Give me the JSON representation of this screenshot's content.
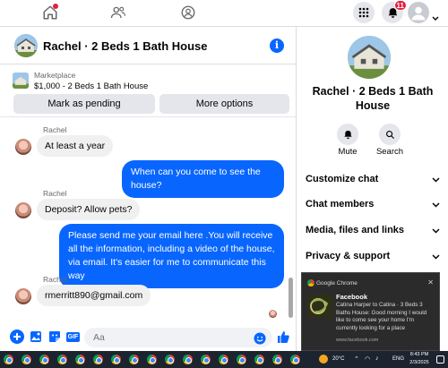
{
  "nav": {
    "notification_count": "11"
  },
  "chat": {
    "title": "Rachel · 2 Beds 1 Bath House",
    "marketplace_label": "Marketplace",
    "listing_price_title": "$1,000 - 2 Beds 1 Bath House",
    "mark_pending_label": "Mark as pending",
    "more_options_label": "More options",
    "messages": [
      {
        "sender": "Rachel",
        "text": "At least a year",
        "direction": "in"
      },
      {
        "text": "When can you come to see the house?",
        "direction": "out"
      },
      {
        "sender": "Rachel",
        "text": "Deposit? Allow pets?",
        "direction": "in"
      },
      {
        "text": "Please send me your email here .You will receive all the information, including a video of the house, via email. It's easier for me to communicate this way",
        "direction": "out"
      },
      {
        "sender": "Rachel",
        "text": "rmerritt890@gmail.com",
        "direction": "in"
      }
    ],
    "composer_placeholder": "Aa"
  },
  "right_panel": {
    "title": "Rachel · 2 Beds 1 Bath House",
    "mute_label": "Mute",
    "search_label": "Search",
    "rows": [
      "Customize chat",
      "Chat members",
      "Media, files and links",
      "Privacy & support"
    ]
  },
  "toast": {
    "app": "Google Chrome",
    "title": "Facebook",
    "body": "Catina Harper to Catina · 3 Beds 3 Baths House: Good morning I would like to come see your home I'm currently looking for a place",
    "link": "www.facebook.com"
  },
  "taskbar": {
    "temperature": "20°C",
    "language": "ENG",
    "time": "8:43 PM",
    "date": "2/3/2025"
  },
  "colors": {
    "accent": "#0866ff",
    "badge": "#e41e3f"
  }
}
